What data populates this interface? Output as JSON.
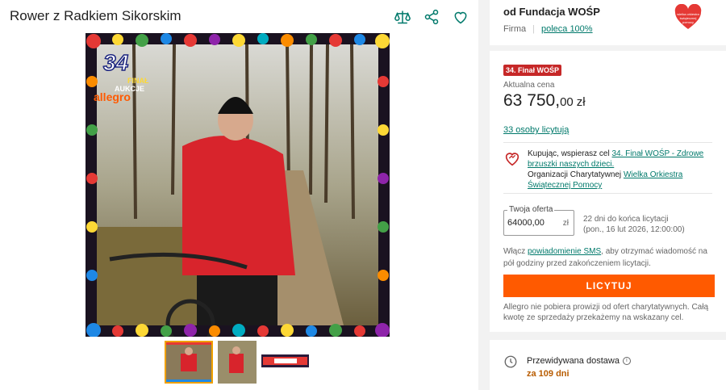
{
  "title": "Rower z Radkiem Sikorskim",
  "icons": [
    "compare-icon",
    "share-icon",
    "heart-icon"
  ],
  "seller": {
    "name": "od Fundacja WOŚP",
    "type": "Firma",
    "recommend": "poleca 100%",
    "logo_text": "wielka orkiestra świątecznej pomocy"
  },
  "auction": {
    "badge": "34. Finał WOŚP",
    "price_label": "Aktualna cena",
    "price_int": "63 750,",
    "price_dec": "00",
    "currency": "zł",
    "bidders": "33 osoby licytują"
  },
  "charity": {
    "text1": "Kupując, wspierasz cel ",
    "goal_link": "34. Finał WOŚP - Zdrowe brzuszki naszych dzieci.",
    "text2": "Organizacji Charytatywnej ",
    "org_link": "Wielka Orkiestra Świątecznej Pomocy"
  },
  "offer": {
    "legend": "Twoja oferta",
    "value": "64000,00",
    "unit": "zł",
    "time_left": "22 dni do końca licytacji",
    "end_date": "(pon., 16 lut 2026, 12:00:00)"
  },
  "sms": {
    "prefix": "Włącz ",
    "link": "powiadomienie SMS",
    "suffix": ", aby otrzymać wiadomość na pół godziny przed zakończeniem licytacji."
  },
  "bid_button": "LICYTUJ",
  "footnote": "Allegro nie pobiera prowizji od ofert charytatywnych. Całą kwotę ze sprzedaży przekażemy na wskazany cel.",
  "delivery": {
    "label": "Przewidywana dostawa",
    "value": "za 109 dni"
  },
  "photo": {
    "badge_number": "34",
    "badge_line1": "FINAŁ",
    "badge_line2": "AUKCJE",
    "brand": "allegro"
  },
  "colors": {
    "accent": "#ff5a00",
    "link": "#00796b",
    "badge": "#c62828",
    "delivery": "#b85c00"
  }
}
